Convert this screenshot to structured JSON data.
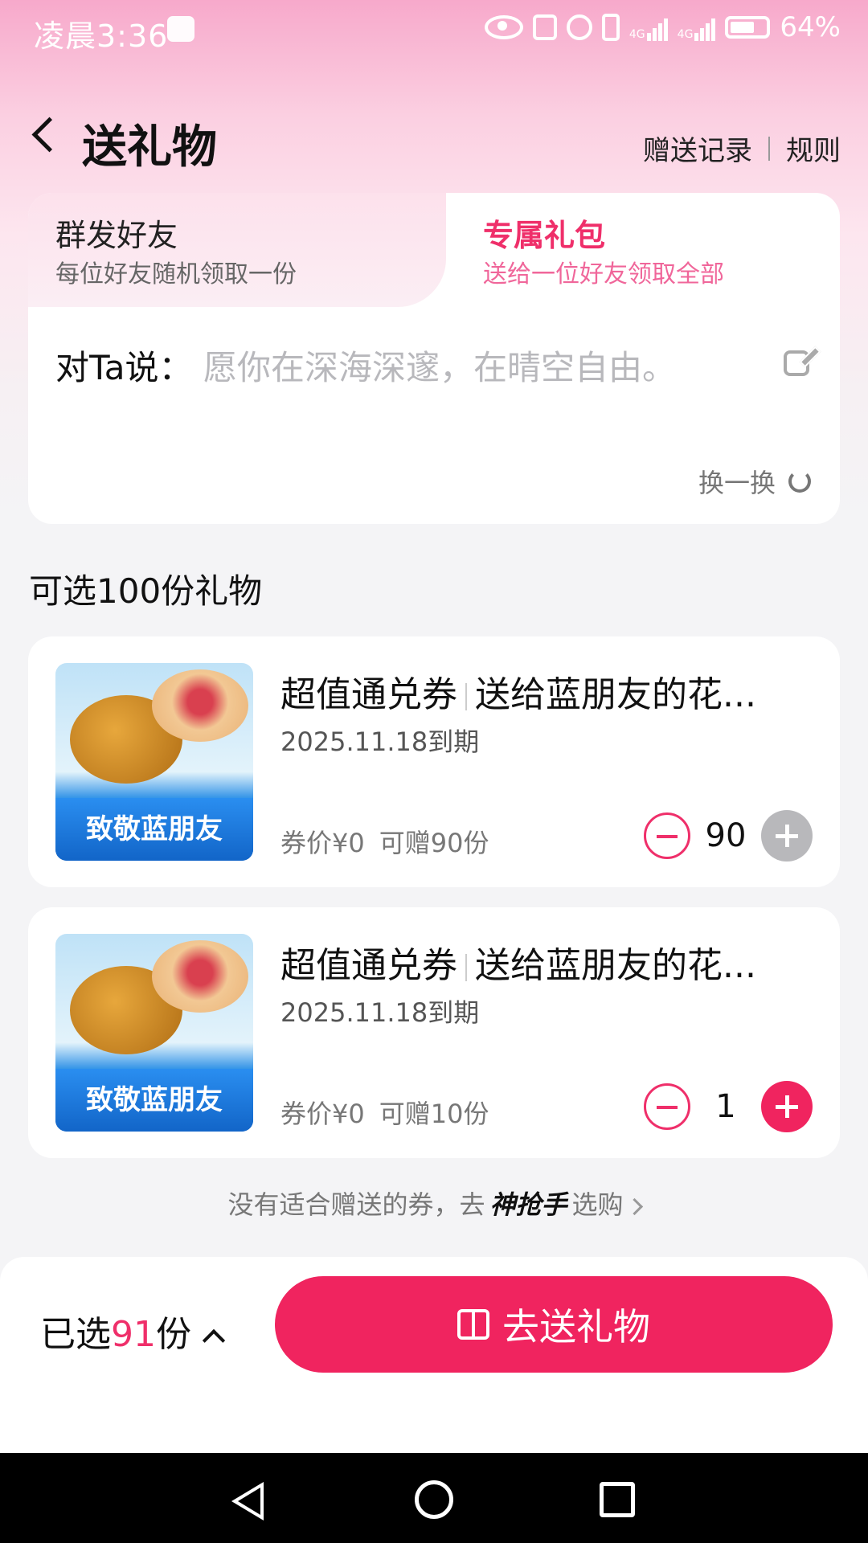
{
  "status_bar": {
    "time": "凌晨3:36",
    "battery": "64%",
    "net1": "4G",
    "net2": "4G"
  },
  "header": {
    "title": "送礼物",
    "record_link": "赠送记录",
    "rules_link": "规则"
  },
  "tabs": [
    {
      "title": "群发好友",
      "subtitle": "每位好友随机领取一份",
      "selected": false
    },
    {
      "title": "专属礼包",
      "subtitle": "送给一位好友领取全部",
      "selected": true
    }
  ],
  "message": {
    "label": "对Ta说：",
    "placeholder": "愿你在深海深邃，在晴空自由。",
    "refresh_label": "换一换"
  },
  "section_title": "可选100份礼物",
  "gifts": [
    {
      "thumb_label": "致敬蓝朋友",
      "type": "超值通兑券",
      "name": "送给蓝朋友的花...",
      "expire": "2025.11.18到期",
      "price": "券价¥0",
      "available": "可赠90份",
      "quantity": "90"
    },
    {
      "thumb_label": "致敬蓝朋友",
      "type": "超值通兑券",
      "name": "送给蓝朋友的花...",
      "expire": "2025.11.18到期",
      "price": "券价¥0",
      "available": "可赠10份",
      "quantity": "1"
    }
  ],
  "hint": {
    "prefix": "没有适合赠送的券，去",
    "brand": "神抢手",
    "suffix": "选购"
  },
  "footer": {
    "selected_prefix": "已选",
    "selected_count": "91",
    "selected_suffix": "份",
    "send_label": "去送礼物"
  },
  "colors": {
    "accent": "#f0245f",
    "tab_active": "#ef2f6a",
    "disabled": "#b8b8bb"
  }
}
